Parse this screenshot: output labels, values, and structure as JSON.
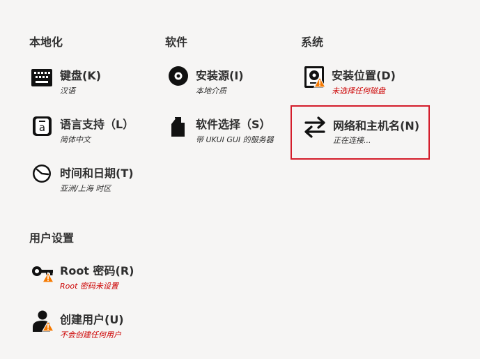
{
  "sections": {
    "localization": "本地化",
    "software": "软件",
    "system": "系统",
    "user_settings": "用户设置"
  },
  "spokes": {
    "keyboard": {
      "title": "键盘(K)",
      "status": "汉语",
      "icon": "keyboard-icon"
    },
    "language": {
      "title": "语言支持（L）",
      "status": "简体中文",
      "icon": "language-icon"
    },
    "datetime": {
      "title": "时间和日期(T)",
      "status": "亚洲/上海 时区",
      "icon": "clock-icon"
    },
    "source": {
      "title": "安装源(I)",
      "status": "本地介质",
      "icon": "disc-icon"
    },
    "software": {
      "title": "软件选择（S）",
      "status": "带 UKUI GUI 的服务器",
      "icon": "package-icon"
    },
    "destination": {
      "title": "安装位置(D)",
      "status": "未选择任何磁盘",
      "icon": "harddisk-warning-icon"
    },
    "network": {
      "title": "网络和主机名(N)",
      "status": "正在连接...",
      "icon": "network-arrows-icon"
    },
    "root": {
      "title": "Root 密码(R)",
      "status": "Root 密码未设置",
      "icon": "key-warning-icon"
    },
    "user": {
      "title": "创建用户(U)",
      "status": "不会创建任何用户",
      "icon": "user-warning-icon"
    }
  },
  "colors": {
    "background": "#f6f5f4",
    "warning_text": "#cc0000",
    "warning_icon": "#f57900",
    "selection_border": "#d41c2a"
  }
}
